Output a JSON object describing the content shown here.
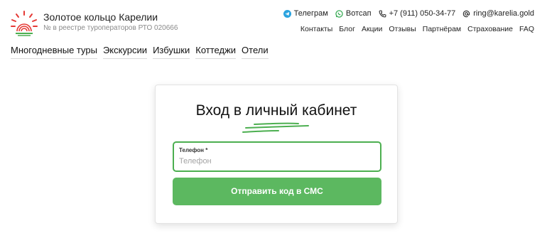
{
  "brand": {
    "title": "Золотое кольцо Карелии",
    "subtitle": "№ в реестре туроператоров РТО 020666",
    "logo_icon": "sun-fingerprint-logo",
    "accent_red": "#e53935",
    "accent_green": "#4caf50"
  },
  "contacts": [
    {
      "icon": "telegram-icon",
      "label": "Телеграм"
    },
    {
      "icon": "whatsapp-icon",
      "label": "Вотсап"
    },
    {
      "icon": "phone-icon",
      "label": "+7 (911) 050-34-77"
    },
    {
      "icon": "at-icon",
      "label": "ring@karelia.gold"
    }
  ],
  "topnav": [
    "Контакты",
    "Блог",
    "Акции",
    "Отзывы",
    "Партнёрам",
    "Страхование",
    "FAQ"
  ],
  "mainnav": [
    "Многодневные туры",
    "Экскурсии",
    "Избушки",
    "Коттеджи",
    "Отели"
  ],
  "login": {
    "title": "Вход в личный кабинет",
    "phone_label": "Телефон *",
    "phone_placeholder": "Телефон",
    "phone_value": "",
    "submit_label": "Отправить код в СМС",
    "button_color": "#5cb860"
  }
}
